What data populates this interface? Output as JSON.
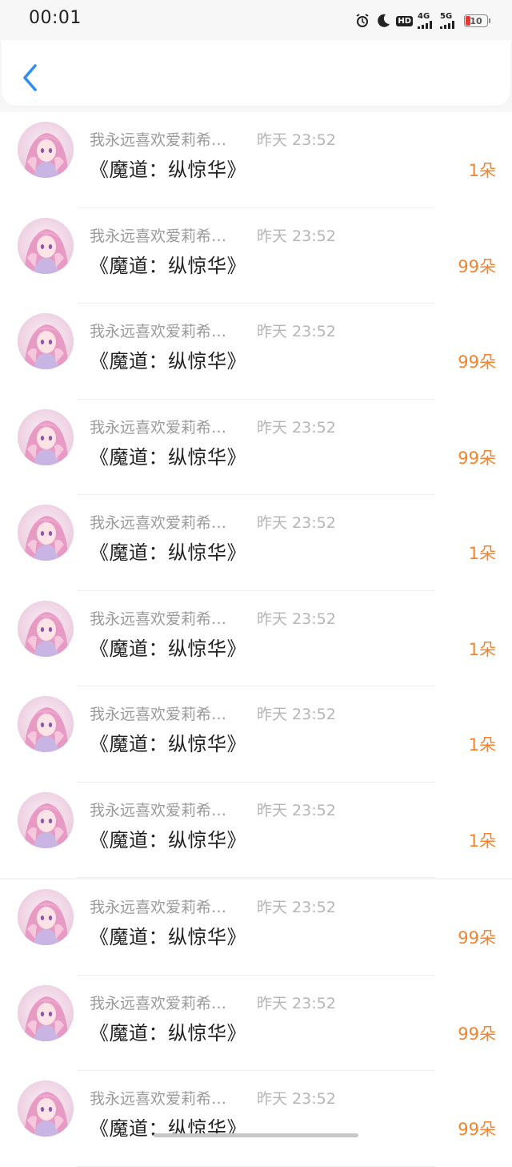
{
  "status_bar": {
    "time": "00:01",
    "icons": [
      "alarm-icon",
      "moon-icon",
      "hd-icon",
      "signal-4g-icon",
      "signal-5g-icon"
    ],
    "hd_label": "HD",
    "sig1_label": "4G",
    "sig2_label": "5G",
    "battery_level": "10",
    "battery_color": "#e53935"
  },
  "header": {
    "back_icon": "chevron-left-icon",
    "accent": "#2f8ff0"
  },
  "list": {
    "accent_count_color": "#f5832b",
    "items": [
      {
        "username": "我永远喜欢爱莉希…",
        "time": "昨天 23:52",
        "title": "《魔道：纵惊华》",
        "count": "1朵"
      },
      {
        "username": "我永远喜欢爱莉希…",
        "time": "昨天 23:52",
        "title": "《魔道：纵惊华》",
        "count": "99朵"
      },
      {
        "username": "我永远喜欢爱莉希…",
        "time": "昨天 23:52",
        "title": "《魔道：纵惊华》",
        "count": "99朵"
      },
      {
        "username": "我永远喜欢爱莉希…",
        "time": "昨天 23:52",
        "title": "《魔道：纵惊华》",
        "count": "99朵"
      },
      {
        "username": "我永远喜欢爱莉希…",
        "time": "昨天 23:52",
        "title": "《魔道：纵惊华》",
        "count": "1朵"
      },
      {
        "username": "我永远喜欢爱莉希…",
        "time": "昨天 23:52",
        "title": "《魔道：纵惊华》",
        "count": "1朵"
      },
      {
        "username": "我永远喜欢爱莉希…",
        "time": "昨天 23:52",
        "title": "《魔道：纵惊华》",
        "count": "1朵"
      },
      {
        "username": "我永远喜欢爱莉希…",
        "time": "昨天 23:52",
        "title": "《魔道：纵惊华》",
        "count": "1朵"
      },
      {
        "username": "我永远喜欢爱莉希…",
        "time": "昨天 23:52",
        "title": "《魔道：纵惊华》",
        "count": "99朵"
      },
      {
        "username": "我永远喜欢爱莉希…",
        "time": "昨天 23:52",
        "title": "《魔道：纵惊华》",
        "count": "99朵"
      },
      {
        "username": "我永远喜欢爱莉希…",
        "time": "昨天 23:52",
        "title": "《魔道：纵惊华》",
        "count": "99朵"
      }
    ]
  }
}
